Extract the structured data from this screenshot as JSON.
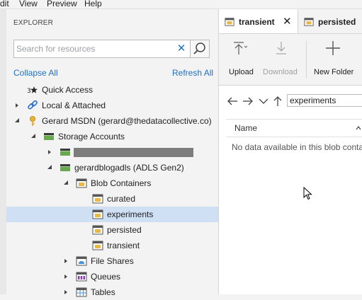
{
  "menu": [
    "dit",
    "View",
    "Preview",
    "Help"
  ],
  "explorer": {
    "title": "EXPLORER",
    "search_placeholder": "Search for resources",
    "collapse_all": "Collapse All",
    "refresh_all": "Refresh All"
  },
  "tree": {
    "quick_access": "Quick Access",
    "local_attached": "Local & Attached",
    "account": "Gerard MSDN (gerard@thedatacollective.co)",
    "storage_accounts": "Storage Accounts",
    "adls": "gerardblogadls (ADLS Gen2)",
    "blob_containers": "Blob Containers",
    "curated": "curated",
    "experiments": "experiments",
    "persisted": "persisted",
    "transient": "transient",
    "file_shares": "File Shares",
    "queues": "Queues",
    "tables": "Tables"
  },
  "tabs": {
    "active": "transient",
    "inactive": "persisted"
  },
  "toolbar": {
    "upload": "Upload",
    "download": "Download",
    "new_folder": "New Folder"
  },
  "content": {
    "path": "experiments",
    "column_name": "Name",
    "empty_message": "No data available in this blob conta"
  },
  "colors": {
    "link": "#1f6fc5",
    "selected_row": "#cfe0f5",
    "container_icon": "#e8b845",
    "storage_icon": "#6aa84f"
  }
}
